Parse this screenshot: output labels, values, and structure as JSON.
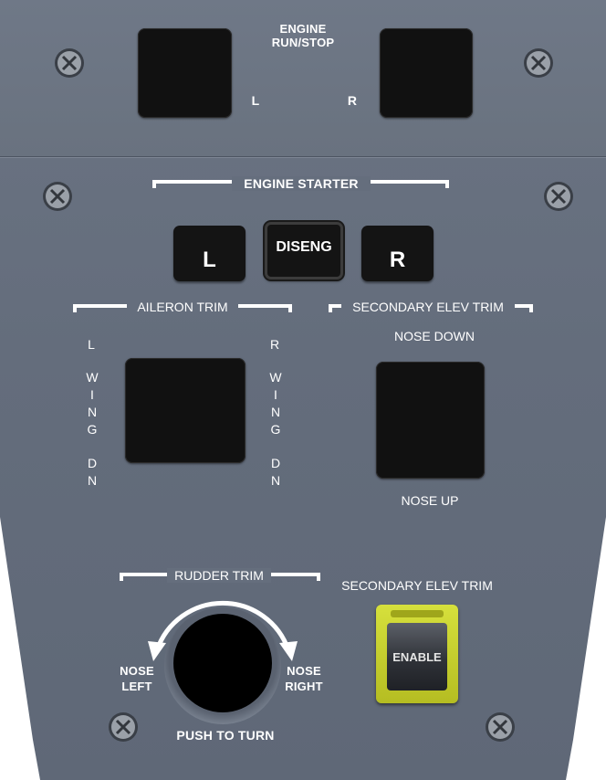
{
  "engine_run_stop": {
    "title_line1": "ENGINE",
    "title_line2": "RUN/STOP",
    "left_label": "L",
    "right_label": "R"
  },
  "engine_starter": {
    "title": "ENGINE STARTER",
    "left_button": "L",
    "diseng_button": "DISENG",
    "right_button": "R"
  },
  "aileron_trim": {
    "title": "AILERON TRIM",
    "left_top": "L",
    "right_top": "R",
    "left_wing": [
      "W",
      "I",
      "N",
      "G"
    ],
    "right_wing": [
      "W",
      "I",
      "N",
      "G"
    ],
    "left_dn": [
      "D",
      "N"
    ],
    "right_dn": [
      "D",
      "N"
    ]
  },
  "secondary_elev_trim": {
    "title": "SECONDARY ELEV TRIM",
    "nose_down": "NOSE DOWN",
    "nose_up": "NOSE UP"
  },
  "rudder_trim": {
    "title": "RUDDER TRIM",
    "nose_left_line1": "NOSE",
    "nose_left_line2": "LEFT",
    "nose_right_line1": "NOSE",
    "nose_right_line2": "RIGHT",
    "push_to_turn": "PUSH TO TURN"
  },
  "secondary_elev_trim_enable": {
    "title": "SECONDARY ELEV TRIM",
    "button_label": "ENABLE",
    "guard_color": "#c8d12e"
  },
  "colors": {
    "panel": "#656e7d",
    "label": "#ffffff",
    "switch_face": "#111111"
  }
}
